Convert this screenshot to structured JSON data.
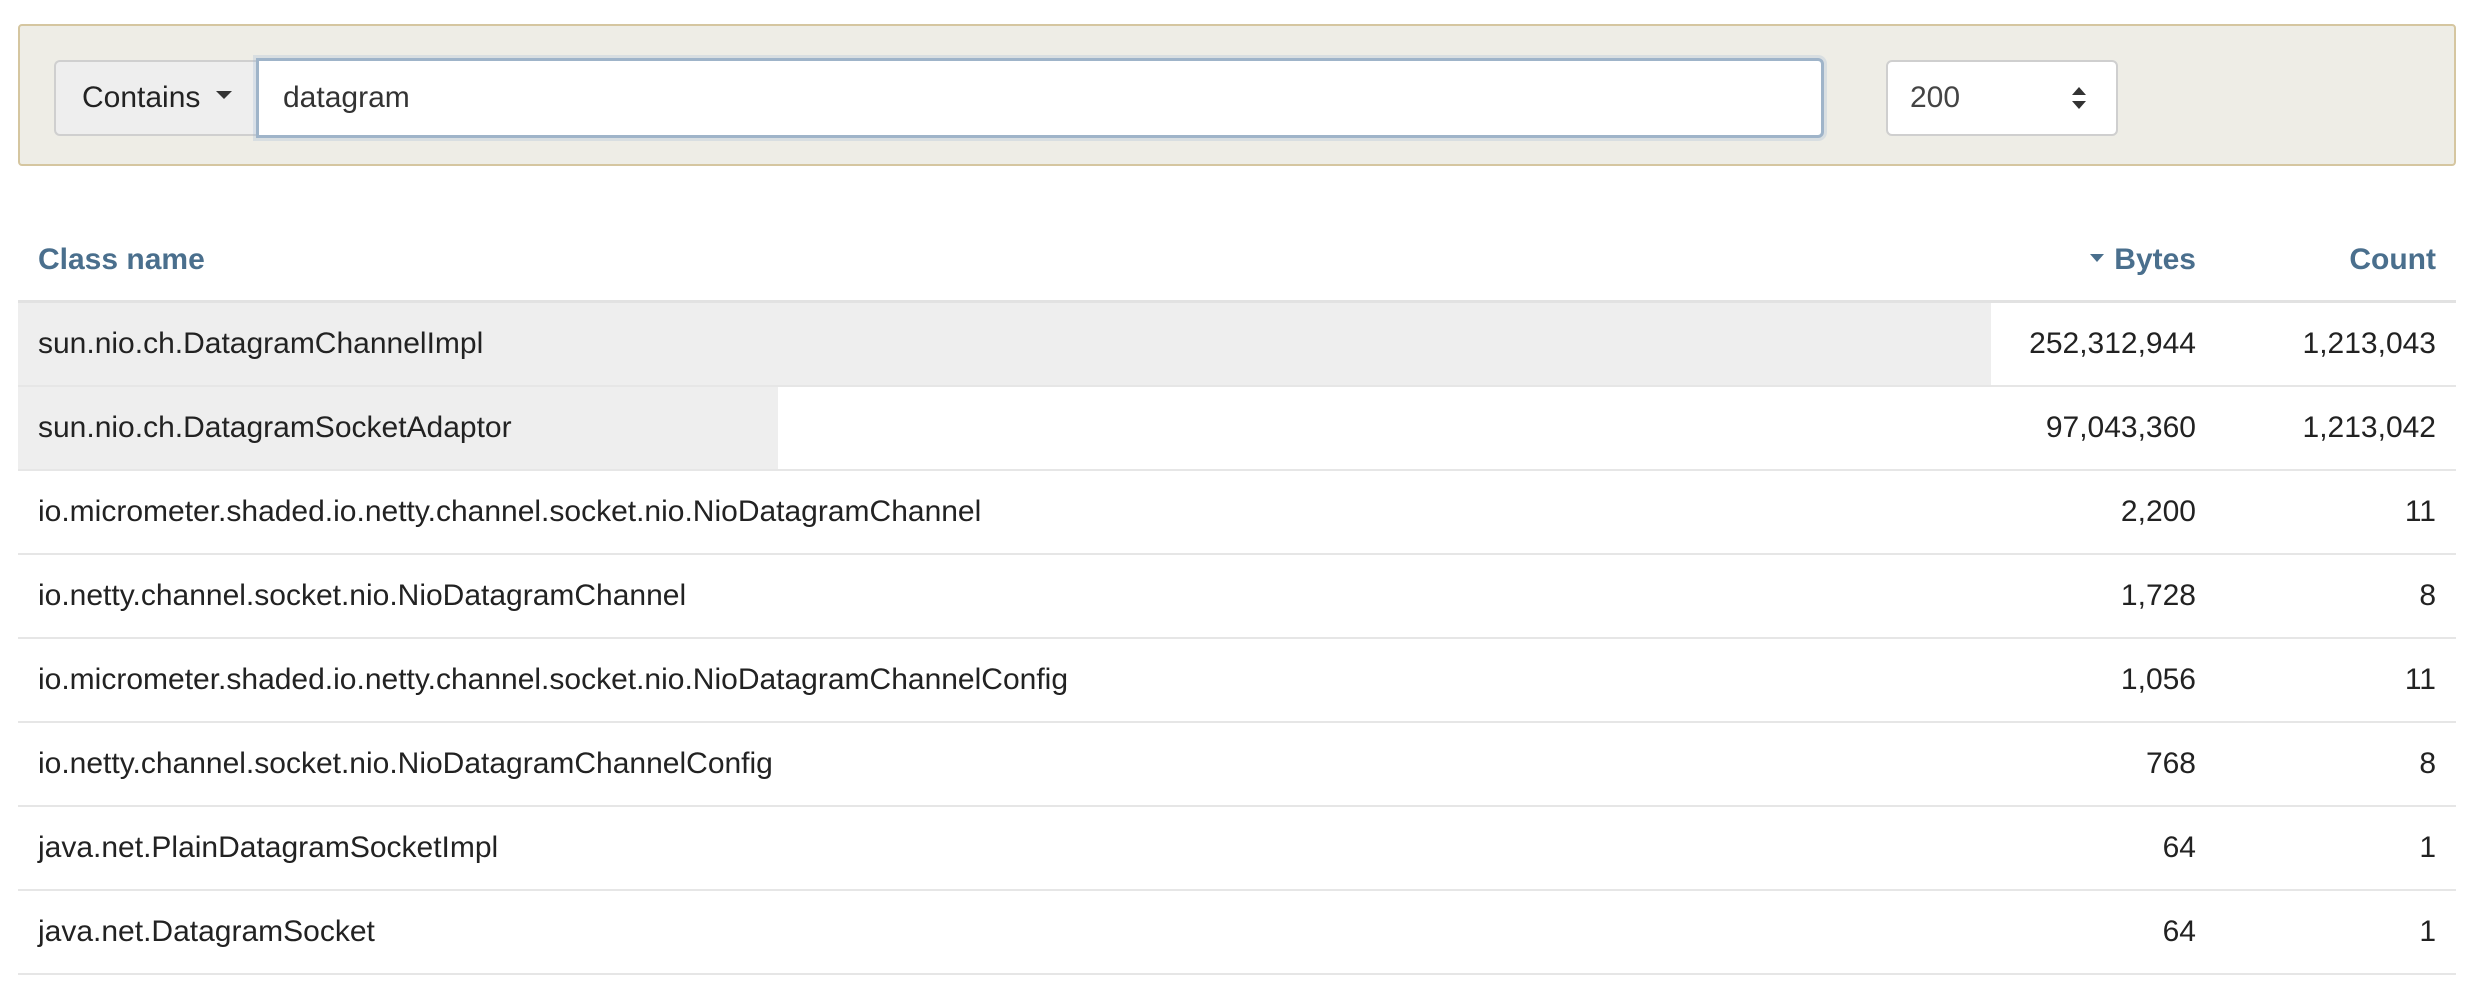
{
  "filter": {
    "mode_label": "Contains",
    "search_value": "datagram",
    "limit_value": "200"
  },
  "table": {
    "headers": {
      "class_name": "Class name",
      "bytes": "Bytes",
      "count": "Count"
    },
    "sort": {
      "column": "bytes",
      "direction": "descending"
    },
    "bar_color": "#eeeeee",
    "header_color": "#4a6f8d",
    "rows": [
      {
        "class_name": "sun.nio.ch.DatagramChannelImpl",
        "bytes": "252,312,944",
        "count": "1,213,043",
        "bytes_share": 1.0
      },
      {
        "class_name": "sun.nio.ch.DatagramSocketAdaptor",
        "bytes": "97,043,360",
        "count": "1,213,042",
        "bytes_share": 0.385
      },
      {
        "class_name": "io.micrometer.shaded.io.netty.channel.socket.nio.NioDatagramChannel",
        "bytes": "2,200",
        "count": "11",
        "bytes_share": 0.0
      },
      {
        "class_name": "io.netty.channel.socket.nio.NioDatagramChannel",
        "bytes": "1,728",
        "count": "8",
        "bytes_share": 0.0
      },
      {
        "class_name": "io.micrometer.shaded.io.netty.channel.socket.nio.NioDatagramChannelConfig",
        "bytes": "1,056",
        "count": "11",
        "bytes_share": 0.0
      },
      {
        "class_name": "io.netty.channel.socket.nio.NioDatagramChannelConfig",
        "bytes": "768",
        "count": "8",
        "bytes_share": 0.0
      },
      {
        "class_name": "java.net.PlainDatagramSocketImpl",
        "bytes": "64",
        "count": "1",
        "bytes_share": 0.0
      },
      {
        "class_name": "java.net.DatagramSocket",
        "bytes": "64",
        "count": "1",
        "bytes_share": 0.0
      }
    ]
  }
}
